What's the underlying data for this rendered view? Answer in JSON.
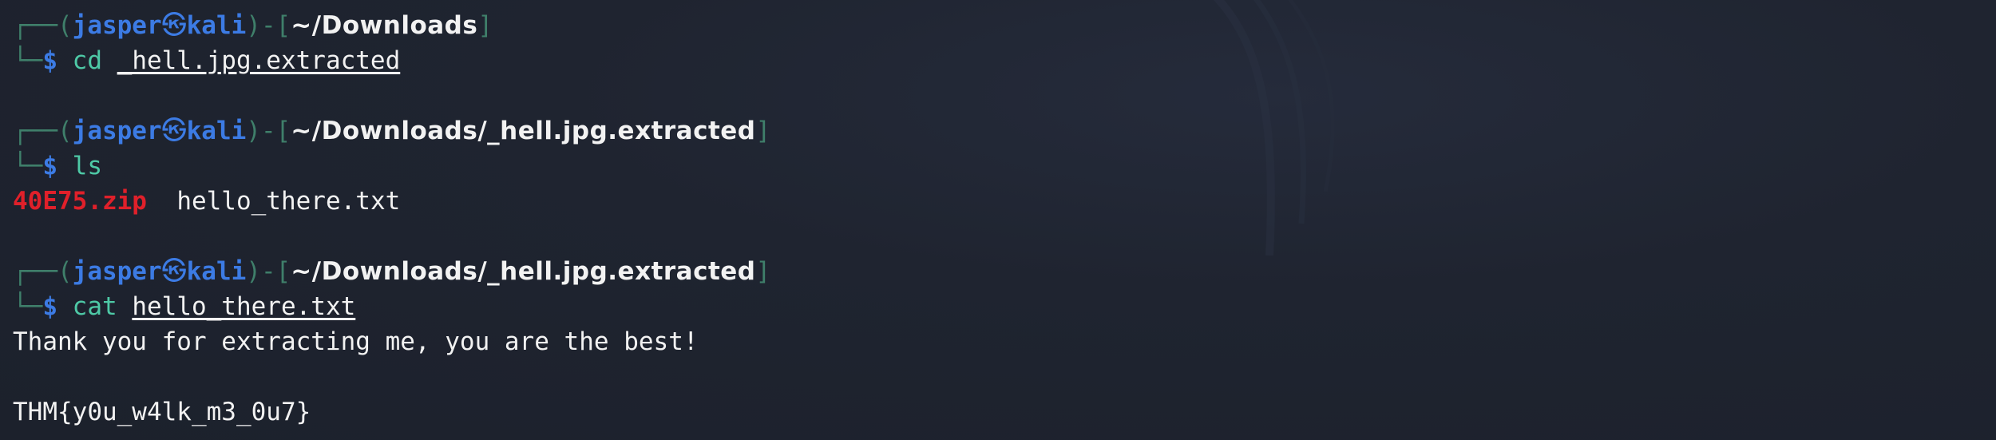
{
  "terminal": {
    "prompt_user": "jasper",
    "prompt_at_symbol": "㉿",
    "prompt_host": "kali",
    "blocks": [
      {
        "path": "~/Downloads",
        "command": "cd",
        "argument": "_hell.jpg.extracted"
      },
      {
        "path": "~/Downloads/_hell.jpg.extracted",
        "command": "ls",
        "argument": "",
        "output": {
          "zip_file": "40E75.zip",
          "text_file": "hello_there.txt"
        }
      },
      {
        "path": "~/Downloads/_hell.jpg.extracted",
        "command": "cat",
        "argument": "hello_there.txt",
        "output": {
          "line1": "Thank you for extracting me, you are the best!",
          "line2": "",
          "line3": "THM{y0u_w4lk_m3_0u7}"
        }
      }
    ]
  }
}
